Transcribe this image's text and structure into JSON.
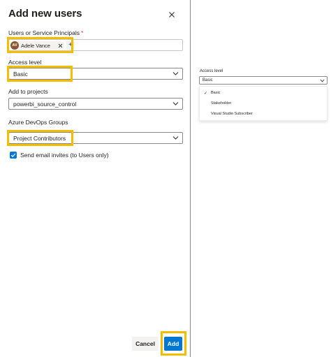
{
  "dialog": {
    "title": "Add new users",
    "close_icon": "close-icon",
    "users": {
      "label": "Users or Service Principals",
      "required_marker": "*",
      "selected_user": {
        "initials": "AV",
        "name": "Adele Vance"
      },
      "add_icon": "plus-icon"
    },
    "access_level": {
      "label": "Access level",
      "value": "Basic"
    },
    "projects": {
      "label": "Add to projects",
      "value": "powerbi_source_control"
    },
    "groups": {
      "label": "Azure DevOps Groups",
      "value": "Project Contributors"
    },
    "email_invites": {
      "label": "Send email invites (to Users only)",
      "checked": true
    },
    "buttons": {
      "cancel": "Cancel",
      "add": "Add"
    }
  },
  "access_dropdown": {
    "label": "Access level",
    "value": "Basic",
    "options": [
      {
        "label": "Basic",
        "selected": true
      },
      {
        "label": "Stakeholder",
        "selected": false
      },
      {
        "label": "Visual Studio Subscriber",
        "selected": false
      }
    ]
  },
  "colors": {
    "highlight": "#f5bd00",
    "primary": "#0078d4",
    "avatar": "#8e562e",
    "required": "#d13438"
  }
}
